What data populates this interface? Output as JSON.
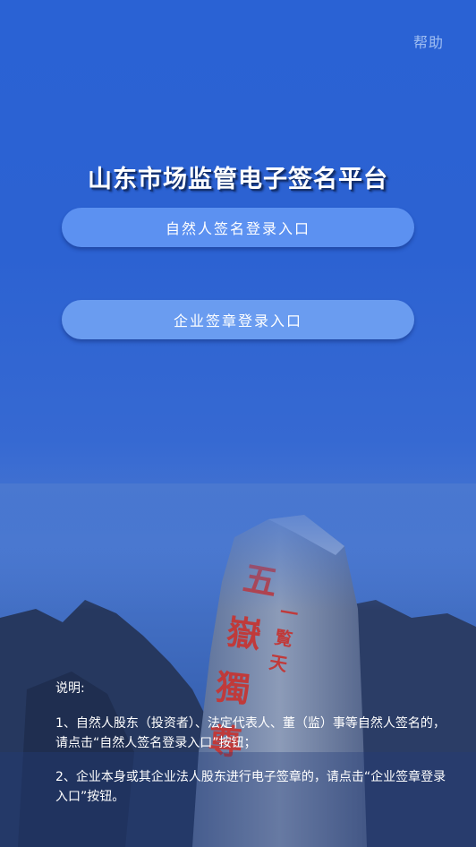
{
  "header": {
    "help_label": "帮助"
  },
  "main": {
    "title": "山东市场监管电子签名平台",
    "buttons": {
      "person_entry": "自然人签名登录入口",
      "company_entry": "企业签章登录入口"
    },
    "background_image": {
      "subject": "泰山“五岳独尊”题刻石",
      "carved_text": "五嶽獨尊",
      "side_text": "一览天下"
    }
  },
  "instructions": {
    "heading": "说明:",
    "items": [
      "1、自然人股东（投资者）、法定代表人、董（监）事等自然人签名的，请点击“自然人签名登录入口”按钮；",
      "2、企业本身或其企业法人股东进行电子签章的，请点击“企业签章登录入口”按钮。"
    ]
  },
  "colors": {
    "background_top": "#2a62d4",
    "button_primary": "#5c91f1",
    "button_secondary": "#6a9cf0",
    "help_text": "#9fbef2",
    "carved_red": "#c03a3a"
  }
}
